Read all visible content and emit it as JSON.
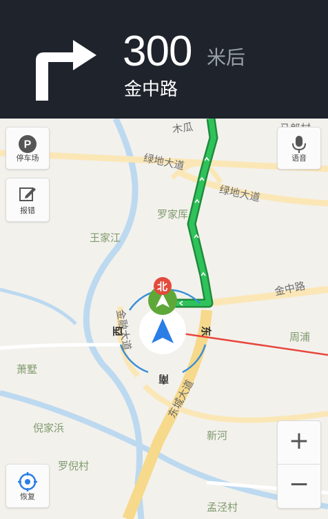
{
  "guidance": {
    "distance": "300",
    "unit": "米后",
    "road": "金中路"
  },
  "buttons": {
    "parking": "停车场",
    "report": "报错",
    "voice": "语音",
    "restore": "恢复",
    "zoom_in": "+",
    "zoom_out": "−"
  },
  "map": {
    "areas": [
      "王家江",
      "罗家厍",
      "周浦",
      "萧墅",
      "倪家浜",
      "罗倪村",
      "新河",
      "孟泾村"
    ],
    "roads": [
      "绿地大道",
      "绿地大道",
      "金中路",
      "东城大道",
      "金融大道",
      "木瓜",
      "马郎村"
    ],
    "compass": {
      "north": "北",
      "east": "东",
      "south": "南",
      "west": "西"
    }
  },
  "colors": {
    "header_bg": "#1e232c",
    "route": "#27b24a",
    "heading_line": "#e8463c",
    "compass_ring": "#3a8fd8",
    "nav_arrow": "#2a7ee6",
    "north_badge": "#e34a3c"
  }
}
